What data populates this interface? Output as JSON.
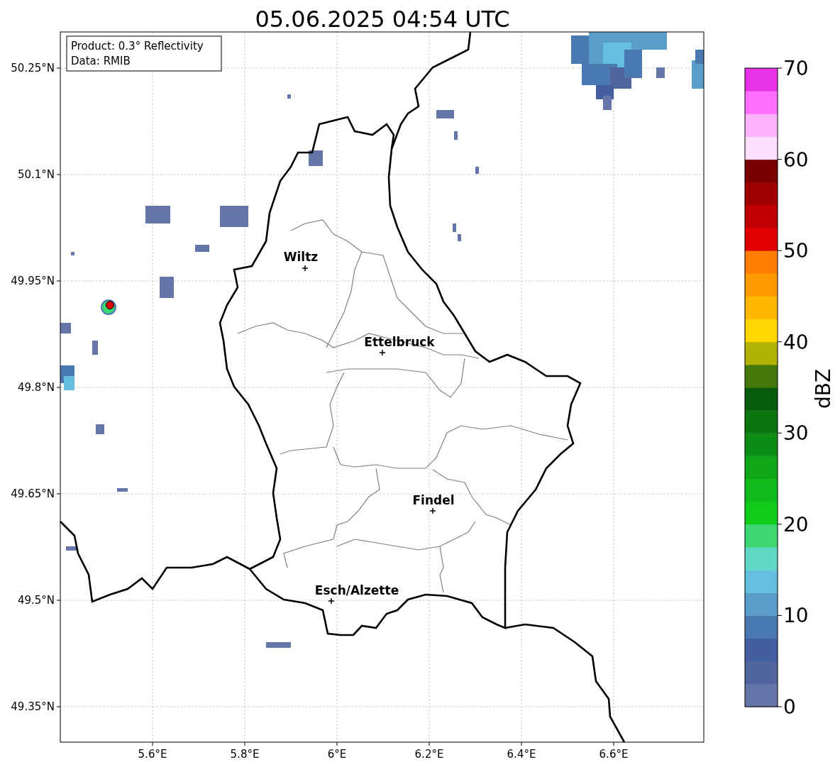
{
  "title": "05.06.2025 04:54 UTC",
  "info_box": {
    "lines": [
      "Product: 0.3° Reflectivity",
      "Data: RMIB"
    ]
  },
  "lat_ticks": [
    "50.25°N",
    "50.1°N",
    "49.95°N",
    "49.8°N",
    "49.65°N",
    "49.5°N",
    "49.35°N"
  ],
  "lon_ticks": [
    "5.6°E",
    "5.8°E",
    "6°E",
    "6.2°E",
    "6.4°E",
    "6.6°E"
  ],
  "cities": [
    {
      "name": "Wiltz"
    },
    {
      "name": "Ettelbruck"
    },
    {
      "name": "Findel"
    },
    {
      "name": "Esch/Alzette"
    }
  ],
  "colorbar": {
    "label": "dBZ",
    "ticks": [
      "70",
      "60",
      "50",
      "40",
      "30",
      "20",
      "10",
      "0"
    ],
    "bins": [
      {
        "color": "#6575a8"
      },
      {
        "color": "#50659e"
      },
      {
        "color": "#435ea1"
      },
      {
        "color": "#4a79b1"
      },
      {
        "color": "#5a9dc8"
      },
      {
        "color": "#63bfdd"
      },
      {
        "color": "#60d8c6"
      },
      {
        "color": "#3dd672"
      },
      {
        "color": "#12cc1c"
      },
      {
        "color": "#12bb1c"
      },
      {
        "color": "#10a618"
      },
      {
        "color": "#0d8d15"
      },
      {
        "color": "#0b7510"
      },
      {
        "color": "#075c0b"
      },
      {
        "color": "#44780a"
      },
      {
        "color": "#b2b206"
      },
      {
        "color": "#ffd600"
      },
      {
        "color": "#ffb700"
      },
      {
        "color": "#ff9a00"
      },
      {
        "color": "#ff7d00"
      },
      {
        "color": "#e00000"
      },
      {
        "color": "#c00000"
      },
      {
        "color": "#a00000"
      },
      {
        "color": "#7a0000"
      },
      {
        "color": "#ffddff"
      },
      {
        "color": "#ffb3ff"
      },
      {
        "color": "#ff6eff"
      },
      {
        "color": "#e832e8"
      }
    ]
  }
}
